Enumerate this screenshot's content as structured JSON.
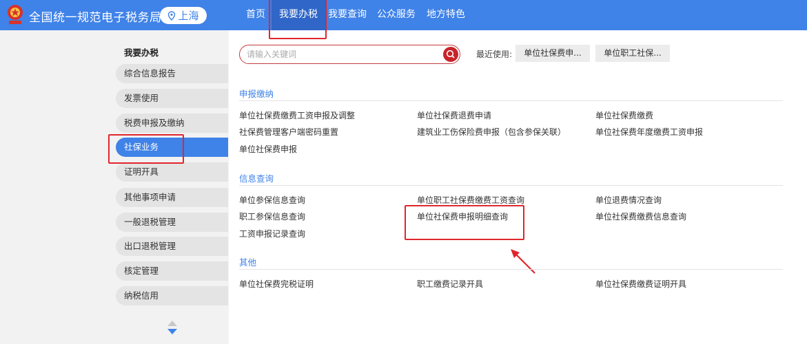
{
  "header": {
    "site_title": "全国统一规范电子税务局",
    "region": "上海",
    "nav": [
      "首页",
      "我要办税",
      "我要查询",
      "公众服务",
      "地方特色"
    ],
    "active_nav": "我要办税"
  },
  "sidebar": {
    "heading": "我要办税",
    "items": [
      "综合信息报告",
      "发票使用",
      "税费申报及缴纳",
      "社保业务",
      "证明开具",
      "其他事项申请",
      "一般退税管理",
      "出口退税管理",
      "核定管理",
      "纳税信用"
    ],
    "active": "社保业务"
  },
  "search": {
    "placeholder": "请输入关键词"
  },
  "recent": {
    "label": "最近使用:",
    "items": [
      "单位社保费申...",
      "单位职工社保..."
    ]
  },
  "sections": [
    {
      "title": "申报缴纳",
      "links": [
        "单位社保费缴费工资申报及调整",
        "单位社保费退费申请",
        "单位社保费缴费",
        "社保费管理客户端密码重置",
        "建筑业工伤保险费申报（包含参保关联）",
        "单位社保费年度缴费工资申报",
        "单位社保费申报"
      ]
    },
    {
      "title": "信息查询",
      "links": [
        "单位参保信息查询",
        "单位职工社保费缴费工资查询",
        "单位退费情况查询",
        "职工参保信息查询",
        "单位社保费申报明细查询",
        "单位社保费缴费信息查询",
        "工资申报记录查询"
      ]
    },
    {
      "title": "其他",
      "links": [
        "单位社保费完税证明",
        "职工缴费记录开具",
        "单位社保费缴费证明开具"
      ]
    }
  ],
  "colors": {
    "brand_blue": "#3f82e8",
    "active_nav": "#2f66c7",
    "annotation_red": "#e0262b"
  }
}
